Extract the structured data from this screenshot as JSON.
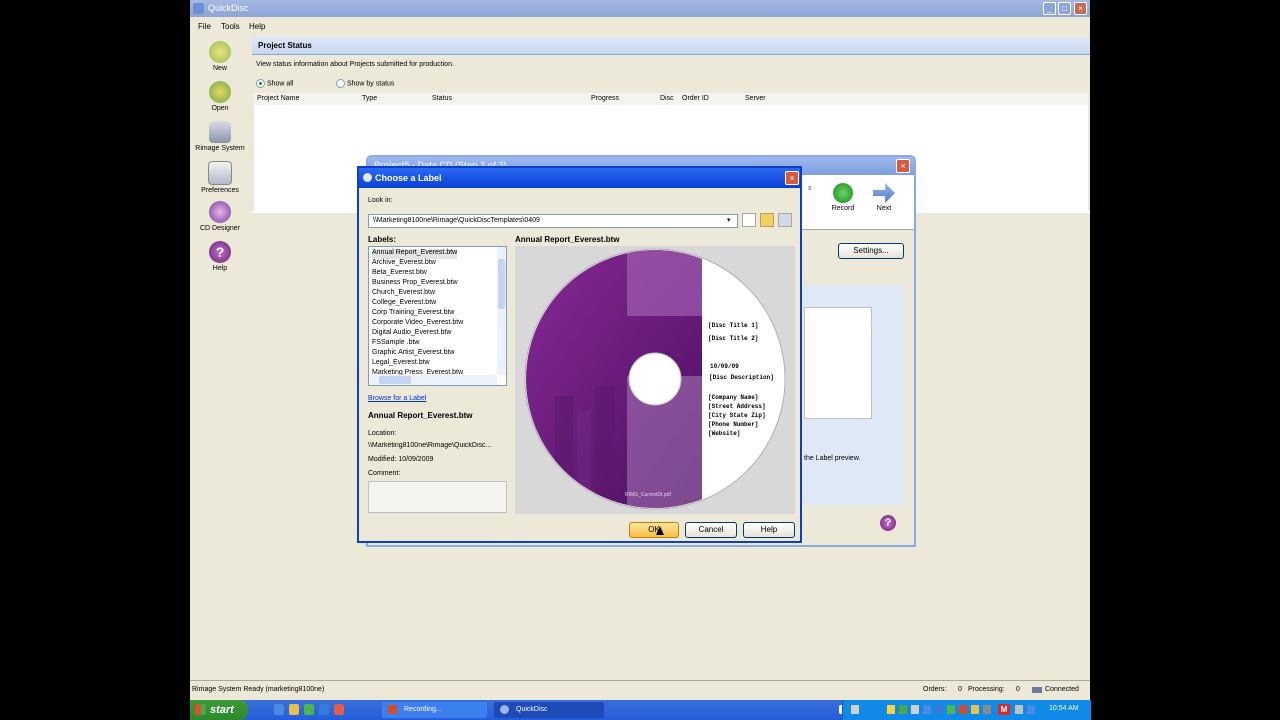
{
  "app": {
    "title": "QuickDisc",
    "menu": [
      "File",
      "Tools",
      "Help"
    ],
    "sidebar": [
      {
        "label": "New",
        "icon": "new-icon"
      },
      {
        "label": "Open",
        "icon": "open-icon"
      },
      {
        "label": "Rimage System",
        "icon": "rimage-system-icon"
      },
      {
        "label": "Preferences",
        "icon": "preferences-icon"
      },
      {
        "label": "CD Designer",
        "icon": "cd-designer-icon"
      },
      {
        "label": "Help",
        "icon": "help-icon"
      }
    ],
    "project_status": {
      "heading": "Project Status",
      "description": "View status information about Projects submitted for production.",
      "show_all": "Show all",
      "show_by_status": "Show by status",
      "columns": [
        "Project Name",
        "Type",
        "Status",
        "Progress",
        "Disc",
        "Order ID",
        "Server"
      ]
    },
    "status_bar": {
      "left": "Rimage System Ready (marketing8100ne)",
      "orders": "Orders:",
      "orders_value": "0",
      "processing": "Processing:",
      "processing_value": "0",
      "connection": "Connected"
    }
  },
  "wizard": {
    "title": "Project5 - Data CD (Step 3 of 3)",
    "record_label": "Record",
    "next_label": "Next",
    "settings_label": "Settings...",
    "label_preview_text": "the Label preview."
  },
  "dialog": {
    "title": "Choose a Label",
    "look_in_label": "Look in:",
    "path": "\\\\Marketing8100ne\\Rimage\\QuickDiscTemplates\\0409",
    "labels_heading": "Labels:",
    "labels": [
      "Annual Report_Everest.btw",
      "Archive_Everest.btw",
      "Beta_Everest.btw",
      "Business Prop_Everest.btw",
      "Church_Everest.btw",
      "College_Everest.btw",
      "Corp Training_Everest.btw",
      "Corporate Video_Everest.btw",
      "Digital Audio_Everest.btw",
      "FSSample .btw",
      "Graphic Artist_Everest.btw",
      "Legal_Everest.btw",
      "Marketing Press_Everest.btw"
    ],
    "browse_link": "Browse for a Label",
    "selected_name": "Annual Report_Everest.btw",
    "location_label": "Location:",
    "location_value": "\\\\Marketing8100ne\\Rimage\\QuickDisc...",
    "modified": "Modified: 10/09/2009",
    "comment_label": "Comment:",
    "preview_title": "Annual Report_Everest.btw",
    "cd_text": {
      "title1": "[Disc Title 1]",
      "title2": "[Disc Title 2]",
      "date": "10/09/09",
      "desc": "[Disc Description]",
      "company": "[Company Name]",
      "street": "[Street Address]",
      "city": "[City State Zip]",
      "phone": "[Phone Number]",
      "website": "[Website]",
      "watermark": "RIMG_CurrentDt.pdf"
    },
    "ok_label": "OK",
    "cancel_label": "Cancel",
    "help_label": "Help"
  },
  "taskbar": {
    "start": "start",
    "tasks": [
      "Recording...",
      "QuickDisc"
    ],
    "clock": "10:54 AM"
  },
  "colors": {
    "xp_blue": "#0841d6",
    "purple": "#6a1f7a",
    "taskbar": "#245edb"
  }
}
